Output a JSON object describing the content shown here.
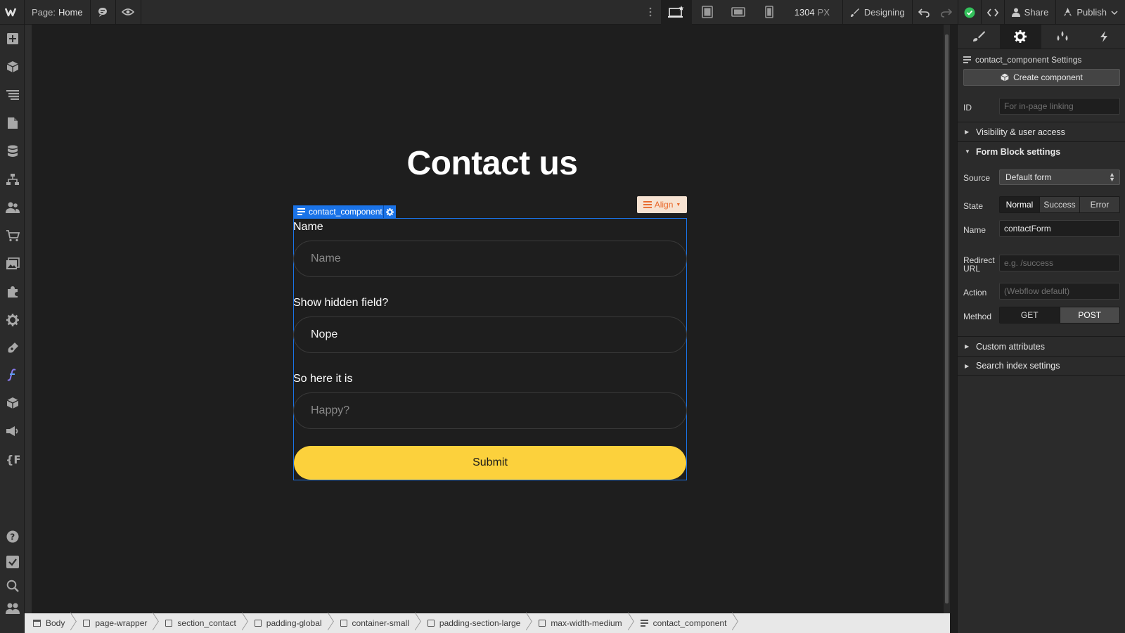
{
  "topbar": {
    "page_label": "Page:",
    "page_name": "Home",
    "width_value": "1304",
    "width_unit": "PX",
    "designing_label": "Designing",
    "share_label": "Share",
    "publish_label": "Publish"
  },
  "canvas": {
    "heading": "Contact us",
    "selected_element": "contact_component",
    "align_label": "Align",
    "fields": [
      {
        "label": "Name",
        "placeholder": "Name"
      },
      {
        "label": "Show hidden field?",
        "value": "Nope"
      },
      {
        "label": "So here it is",
        "placeholder": "Happy?"
      }
    ],
    "submit_label": "Submit"
  },
  "breadcrumbs": [
    "Body",
    "page-wrapper",
    "section_contact",
    "padding-global",
    "container-small",
    "padding-section-large",
    "max-width-medium",
    "contact_component"
  ],
  "settings_panel": {
    "title": "contact_component Settings",
    "create_component_label": "Create component",
    "id_label": "ID",
    "id_placeholder": "For in-page linking",
    "visibility_section": "Visibility & user access",
    "form_block_section": "Form Block settings",
    "source_label": "Source",
    "source_value": "Default form",
    "state_label": "State",
    "state_options": [
      "Normal",
      "Success",
      "Error"
    ],
    "state_selected": "Normal",
    "name_label": "Name",
    "name_value": "contactForm",
    "redirect_label_1": "Redirect",
    "redirect_label_2": "URL",
    "redirect_placeholder": "e.g. /success",
    "action_label": "Action",
    "action_placeholder": "(Webflow default)",
    "method_label": "Method",
    "method_options": [
      "GET",
      "POST"
    ],
    "method_selected": "POST",
    "custom_attributes_section": "Custom attributes",
    "search_index_section": "Search index settings"
  },
  "colors": {
    "selection_blue": "#1a73e8",
    "submit_yellow": "#fcd13c",
    "align_orange": "#e8682a",
    "status_green": "#33c15b"
  }
}
